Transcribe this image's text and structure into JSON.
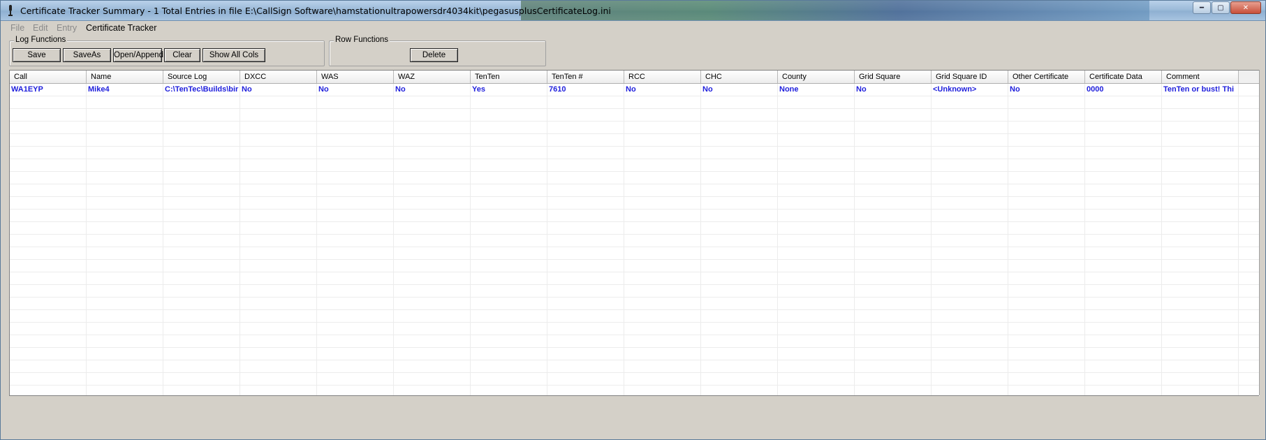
{
  "window": {
    "title": "Certificate Tracker Summary - 1 Total Entries in file E:\\CallSign Software\\hamstationultrapowersdr4034kit\\pegasusplusCertificateLog.ini"
  },
  "menu": {
    "items": [
      {
        "label": "File",
        "enabled": false
      },
      {
        "label": "Edit",
        "enabled": false
      },
      {
        "label": "Entry",
        "enabled": false
      },
      {
        "label": "Certificate Tracker",
        "enabled": true
      }
    ]
  },
  "log_functions": {
    "title": "Log Functions",
    "buttons": {
      "save": "Save",
      "save_as": "SaveAs",
      "open_append": "Open/Append",
      "clear": "Clear",
      "show_all_cols": "Show All Cols"
    }
  },
  "row_functions": {
    "title": "Row Functions",
    "buttons": {
      "delete": "Delete"
    }
  },
  "table": {
    "columns": [
      "Call",
      "Name",
      "Source Log",
      "DXCC",
      "WAS",
      "WAZ",
      "TenTen",
      "TenTen #",
      "RCC",
      "CHC",
      "County",
      "Grid Square",
      "Grid Square ID",
      "Other Certificate",
      "Certificate Data",
      "Comment"
    ],
    "rows": [
      [
        "WA1EYP",
        "Mike4",
        "C:\\TenTec\\Builds\\bir",
        "No",
        "No",
        "No",
        "Yes",
        "7610",
        "No",
        "No",
        "None",
        "No",
        "<Unknown>",
        "No",
        "0000",
        "TenTen or bust! Thi"
      ]
    ]
  },
  "colors": {
    "data_text": "#1e1edc",
    "window_bg": "#d4d0c8"
  }
}
